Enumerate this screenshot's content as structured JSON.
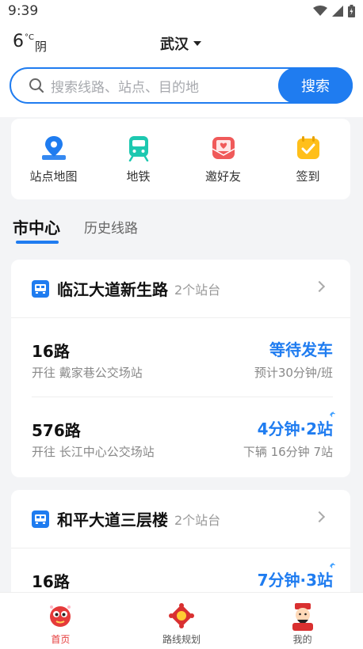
{
  "status_bar": {
    "time": "9:39"
  },
  "header": {
    "weather": {
      "temperature": "6",
      "unit": "°C",
      "condition": "阴"
    },
    "city": "武汉"
  },
  "search": {
    "placeholder": "搜索线路、站点、目的地",
    "button": "搜索"
  },
  "quick_actions": [
    {
      "label": "站点地图",
      "icon": "map-pin-icon",
      "color": "#1f7cf0"
    },
    {
      "label": "地铁",
      "icon": "subway-icon",
      "color": "#1dc8b0"
    },
    {
      "label": "邀好友",
      "icon": "invite-envelope-icon",
      "color": "#f05a5a"
    },
    {
      "label": "签到",
      "icon": "calendar-check-icon",
      "color": "#ffbf1a"
    }
  ],
  "tabs": {
    "active": "市中心",
    "inactive": "历史线路"
  },
  "stations": [
    {
      "name": "临江大道新生路",
      "count": "2个站台",
      "routes": [
        {
          "number": "16路",
          "direction": "开往 戴家巷公交场站",
          "status": "等待发车",
          "detail": "预计30分钟/班"
        },
        {
          "number": "576路",
          "direction": "开往 长江中心公交场站",
          "status": "4分钟·2站",
          "detail": "下辆 16分钟 7站"
        }
      ]
    },
    {
      "name": "和平大道三层楼",
      "count": "2个站台",
      "routes": [
        {
          "number": "16路",
          "status": "7分钟·3站"
        }
      ]
    }
  ],
  "bottom_nav": [
    {
      "label": "首页",
      "active": true
    },
    {
      "label": "路线规划",
      "active": false
    },
    {
      "label": "我的",
      "active": false
    }
  ],
  "colors": {
    "accent": "#1f7cf0",
    "active_nav": "#e53a3a"
  }
}
